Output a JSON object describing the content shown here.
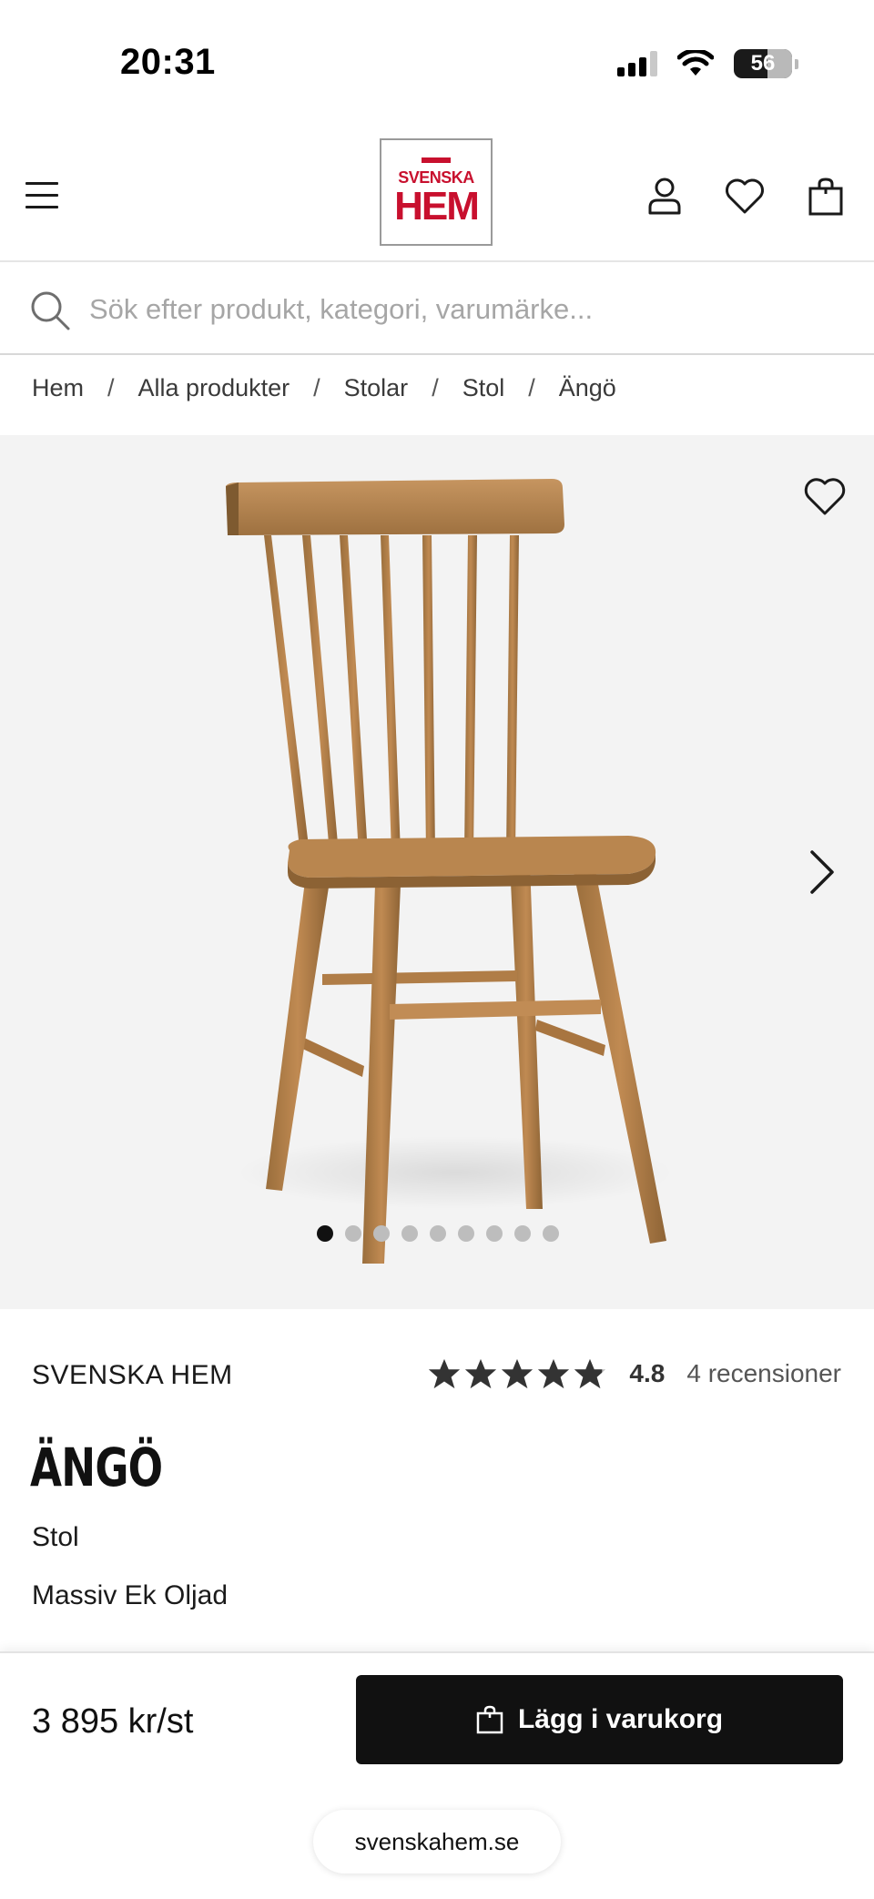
{
  "status_bar": {
    "time": "20:31",
    "battery": "56"
  },
  "header": {
    "logo": {
      "line1": "SVENSKA",
      "line2": "HEM",
      "color": "#c8102e"
    },
    "icons": [
      "menu-icon",
      "user-icon",
      "heart-icon",
      "shopping-bag-icon"
    ]
  },
  "search": {
    "placeholder": "Sök efter produkt, kategori, varumärke..."
  },
  "breadcrumb": [
    {
      "label": "Hem"
    },
    {
      "label": "Alla produkter"
    },
    {
      "label": "Stolar"
    },
    {
      "label": "Stol"
    },
    {
      "label": "Ängö"
    }
  ],
  "gallery": {
    "image_subject": "wooden-spindle-chair",
    "image_count": 9,
    "active_index": 0
  },
  "product": {
    "brand": "SVENSKA HEM",
    "rating_value": "4.8",
    "rating_stars": 4.8,
    "review_count_text": "4 recensioner",
    "name": "ÄNGÖ",
    "type": "Stol",
    "material": "Massiv Ek Oljad"
  },
  "purchase": {
    "price": "3 895 kr/st",
    "add_to_cart_label": "Lägg i varukorg"
  },
  "browser": {
    "url": "svenskahem.se"
  }
}
